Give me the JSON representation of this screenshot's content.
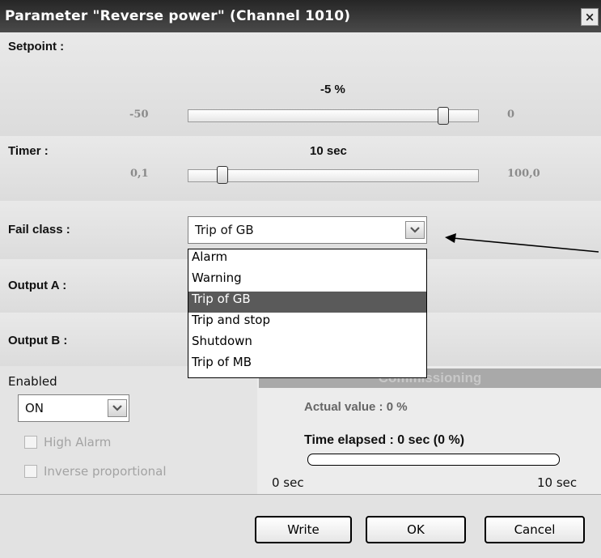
{
  "window": {
    "title": "Parameter \"Reverse power\" (Channel 1010)",
    "close_glyph": "×"
  },
  "setpoint": {
    "label": "Setpoint :",
    "value_text": "-5 %",
    "min": "-50",
    "max": "0",
    "value": -5
  },
  "timer": {
    "label": "Timer :",
    "value_text": "10 sec",
    "min": "0,1",
    "max": "100,0"
  },
  "fail_class": {
    "label": "Fail class :",
    "selected": "Trip of GB",
    "options": [
      "Alarm",
      "Warning",
      "Trip of GB",
      "Trip and stop",
      "Shutdown",
      "Trip of MB"
    ],
    "highlighted_index": 2
  },
  "output_a": {
    "label": "Output A :"
  },
  "output_b": {
    "label": "Output B :"
  },
  "enabled": {
    "label": "Enabled",
    "selected": "ON"
  },
  "options": {
    "high_alarm": "High Alarm",
    "inverse_proportional": "Inverse proportional"
  },
  "commissioning": {
    "header": "Commissioning",
    "actual_value": "Actual value : 0 %",
    "time_elapsed": "Time elapsed : 0 sec (0 %)",
    "progress": 0,
    "range_min": "0 sec",
    "range_max": "10 sec"
  },
  "buttons": {
    "write": "Write",
    "ok": "OK",
    "cancel": "Cancel"
  },
  "icons": {
    "dropdown_arrow": "chevron-down-icon",
    "close": "close-icon"
  },
  "colors": {
    "titlebar": "#3a3a3a",
    "highlight": "#5a5a5a",
    "annotation": "#000000"
  }
}
